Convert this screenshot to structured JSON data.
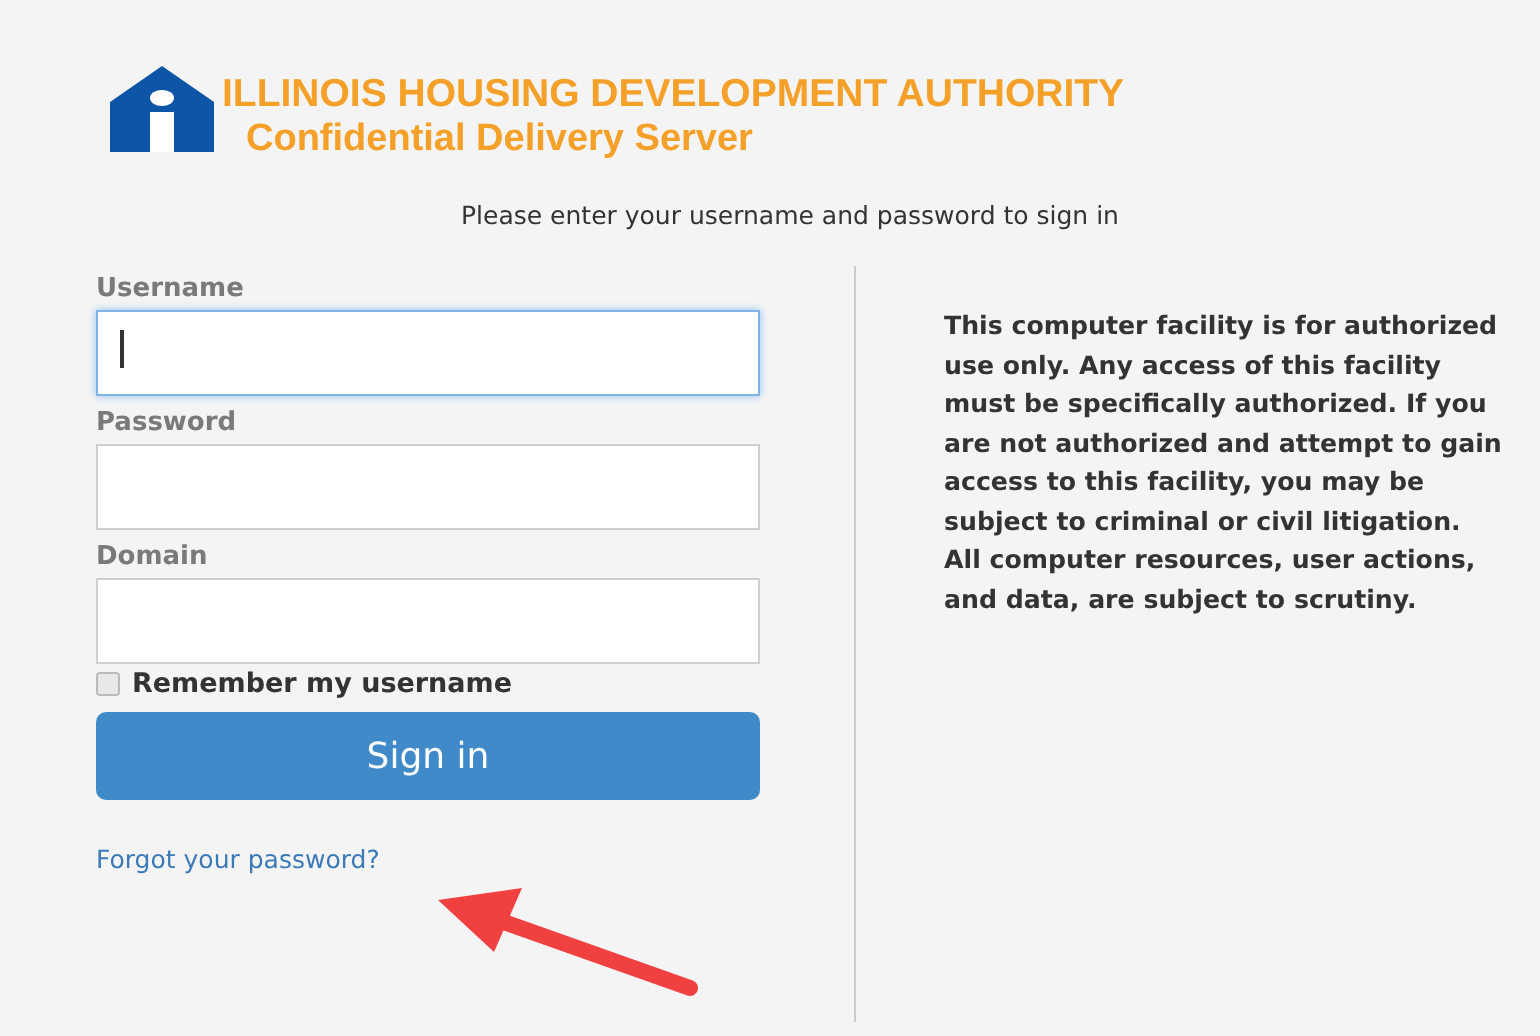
{
  "header": {
    "title": "ILLINOIS HOUSING DEVELOPMENT AUTHORITY",
    "subtitle": "Confidential Delivery Server"
  },
  "prompt": "Please enter your username and password to sign in",
  "fields": [
    {
      "label": "Username",
      "focused": true
    },
    {
      "label": "Password",
      "focused": false
    },
    {
      "label": "Domain",
      "focused": false
    }
  ],
  "remember": {
    "label": "Remember my username",
    "checked": false
  },
  "sign_in_button": "Sign in",
  "forgot_link": "Forgot your password?",
  "notice": "This computer facility is for authorized use only. Any access of this facility must be specifically authorized. If you are not authorized and attempt to gain access to this facility, you may be subject to criminal or civil litigation. All computer resources, user actions, and data, are subject to scrutiny."
}
